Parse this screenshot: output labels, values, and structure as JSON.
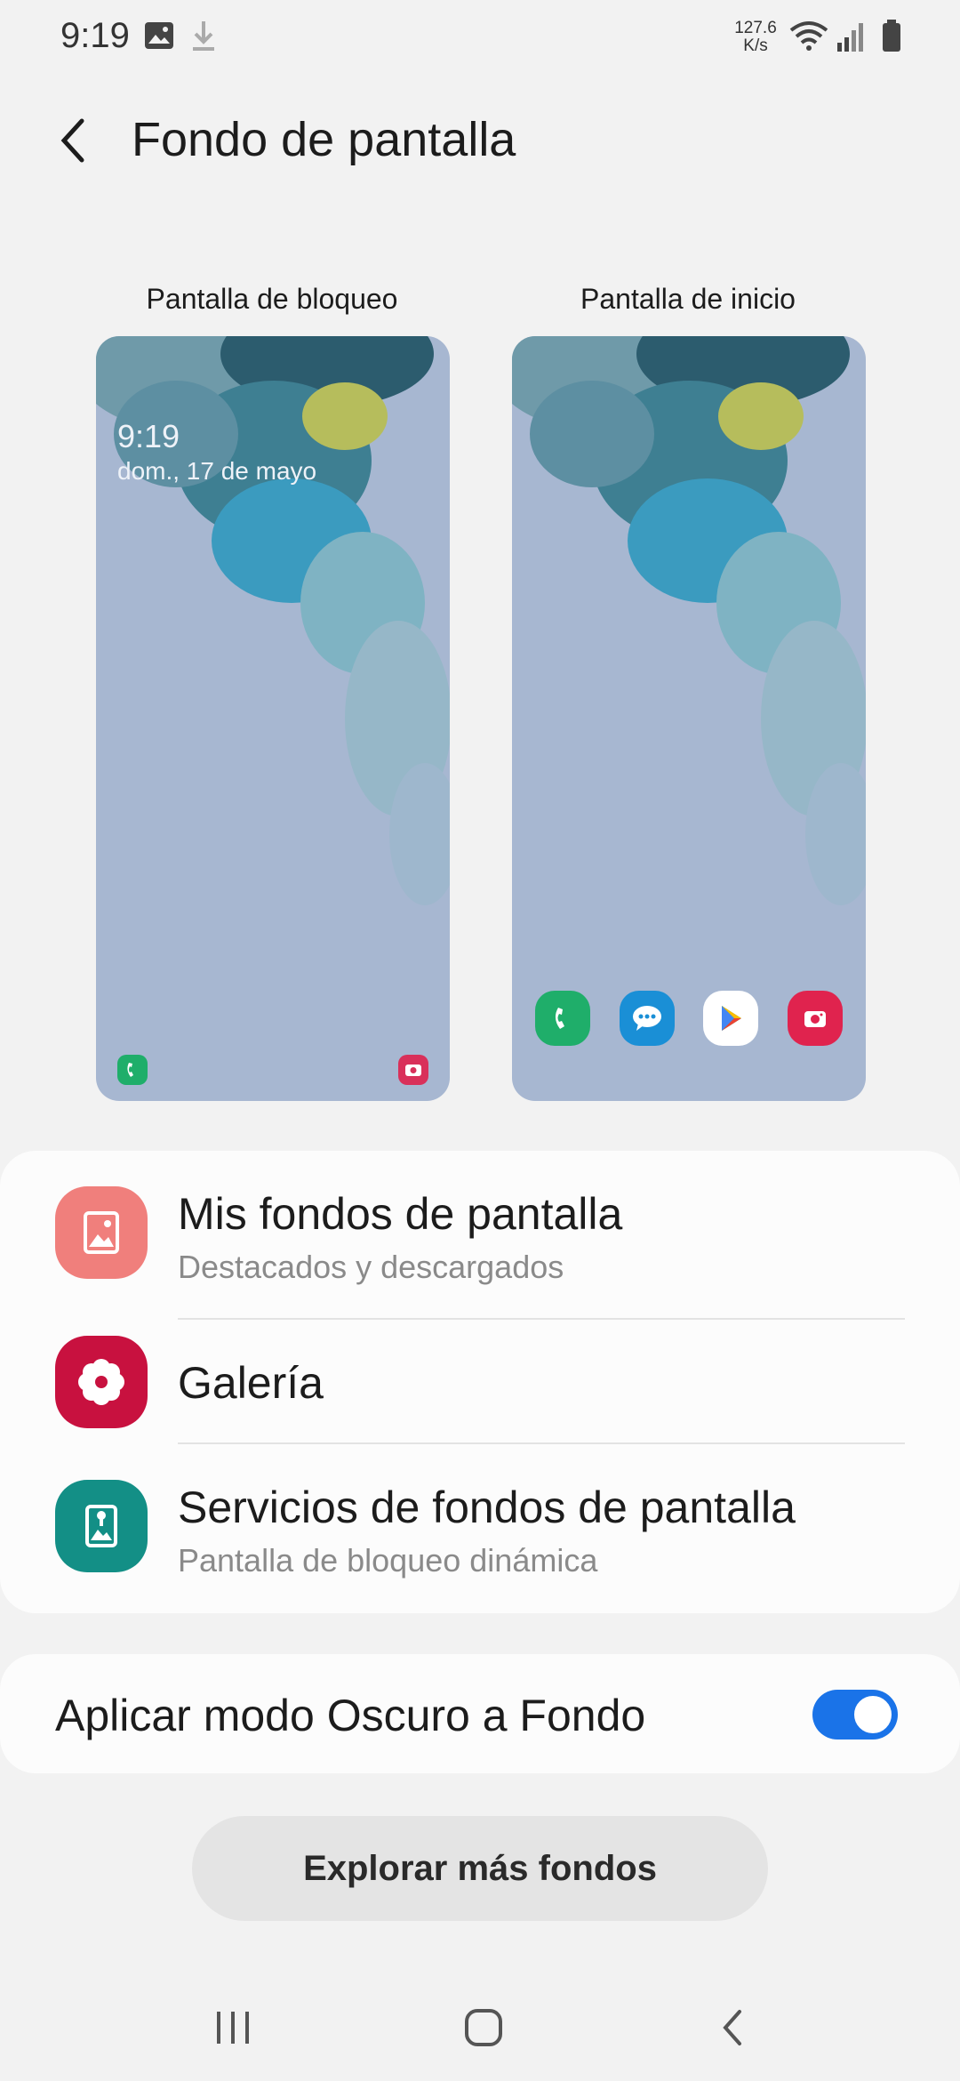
{
  "status_bar": {
    "time": "9:19",
    "speed_value": "127.6",
    "speed_unit": "K/s",
    "icons": [
      "gallery-icon",
      "download-icon",
      "wifi-icon",
      "signal-icon",
      "battery-icon"
    ]
  },
  "header": {
    "title": "Fondo de pantalla",
    "back_icon": "back-arrow-icon"
  },
  "previews": {
    "lock": {
      "label": "Pantalla de bloqueo",
      "time": "9:19",
      "date": "dom., 17 de mayo",
      "shortcuts": [
        "phone-icon",
        "camera-icon"
      ]
    },
    "home": {
      "label": "Pantalla de inicio",
      "dock": [
        "phone-icon",
        "messages-icon",
        "play-store-icon",
        "camera-icon"
      ]
    }
  },
  "menu": {
    "items": [
      {
        "title": "Mis fondos de pantalla",
        "subtitle": "Destacados y descargados",
        "icon": "my-wallpapers-icon",
        "color": "#f07f7c"
      },
      {
        "title": "Galería",
        "subtitle": "",
        "icon": "gallery-flower-icon",
        "color": "#c8113f"
      },
      {
        "title": "Servicios de fondos de pantalla",
        "subtitle": "Pantalla de bloqueo dinámica",
        "icon": "wallpaper-services-icon",
        "color": "#138f86"
      }
    ]
  },
  "dark_mode": {
    "label": "Aplicar modo Oscuro a Fondo",
    "enabled": true,
    "accent": "#1a73e8"
  },
  "explore_button": "Explorar más fondos",
  "nav_bar": [
    "recents-icon",
    "home-icon",
    "back-icon"
  ]
}
